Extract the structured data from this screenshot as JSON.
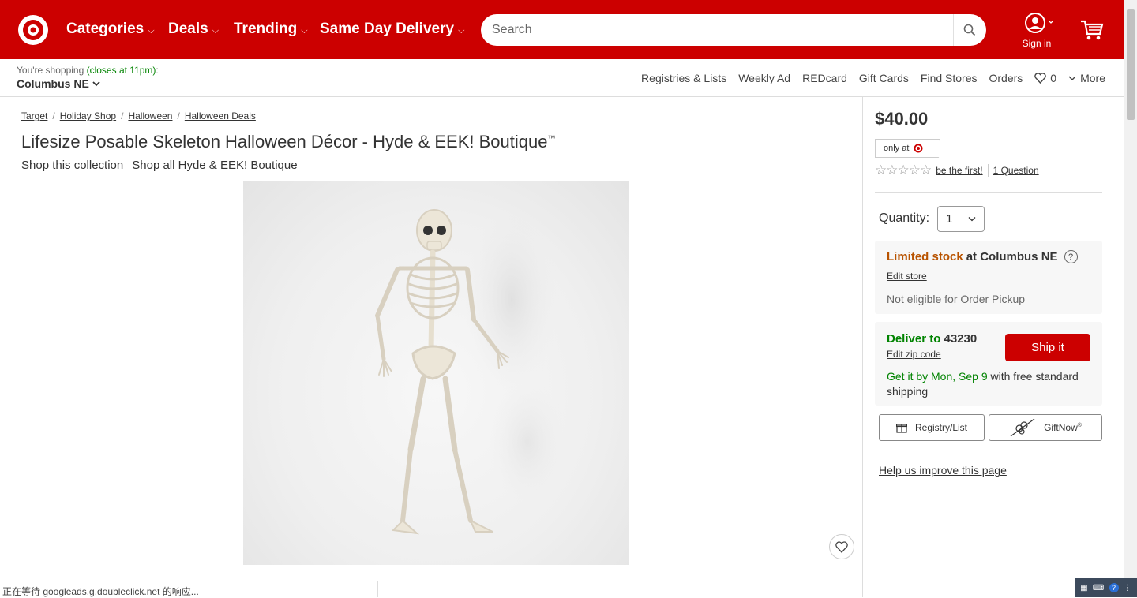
{
  "header": {
    "nav": [
      {
        "label": "Categories"
      },
      {
        "label": "Deals"
      },
      {
        "label": "Trending"
      },
      {
        "label": "Same Day Delivery"
      }
    ],
    "search": {
      "placeholder": "Search"
    },
    "sign_in": "Sign in",
    "brand_color": "#cc0000"
  },
  "subheader": {
    "shopping_prefix": "You're shopping ",
    "closes": "(closes at 11pm)",
    "colon": ":",
    "store": "Columbus NE",
    "links": [
      "Registries & Lists",
      "Weekly Ad",
      "REDcard",
      "Gift Cards",
      "Find Stores",
      "Orders"
    ],
    "favorites_count": "0",
    "more": "More"
  },
  "breadcrumb": [
    "Target",
    "Holiday Shop",
    "Halloween",
    "Halloween Deals"
  ],
  "product": {
    "title": "Lifesize Posable Skeleton Halloween Décor - Hyde & EEK! Boutique",
    "trademark": "™",
    "shop_collection": "Shop this collection",
    "shop_all": "Shop all Hyde & EEK! Boutique",
    "image_alt": "skeleton figure"
  },
  "buybox": {
    "price": "$40.00",
    "only_at": "only at",
    "be_first": "be the first!",
    "questions": "1 Question",
    "quantity_label": "Quantity:",
    "quantity_value": "1",
    "stock_status": "Limited stock",
    "stock_at": " at Columbus NE",
    "edit_store": "Edit store",
    "pickup_note": "Not eligible for Order Pickup",
    "deliver_label": "Deliver to",
    "zip": "43230",
    "edit_zip": "Edit zip code",
    "ship_button": "Ship it",
    "ship_date": "Get it by Mon, Sep 9",
    "ship_rest": " with free standard shipping",
    "registry_button": "Registry/List",
    "giftnow_button": "GiftNow",
    "giftnow_mark": "®",
    "improve_link": "Help us improve this page"
  },
  "statusbar": {
    "text": "正在等待 googleads.g.doubleclick.net 的响应..."
  },
  "colors": {
    "accent": "#cc0000",
    "limited": "#b85300",
    "green": "#008300"
  }
}
